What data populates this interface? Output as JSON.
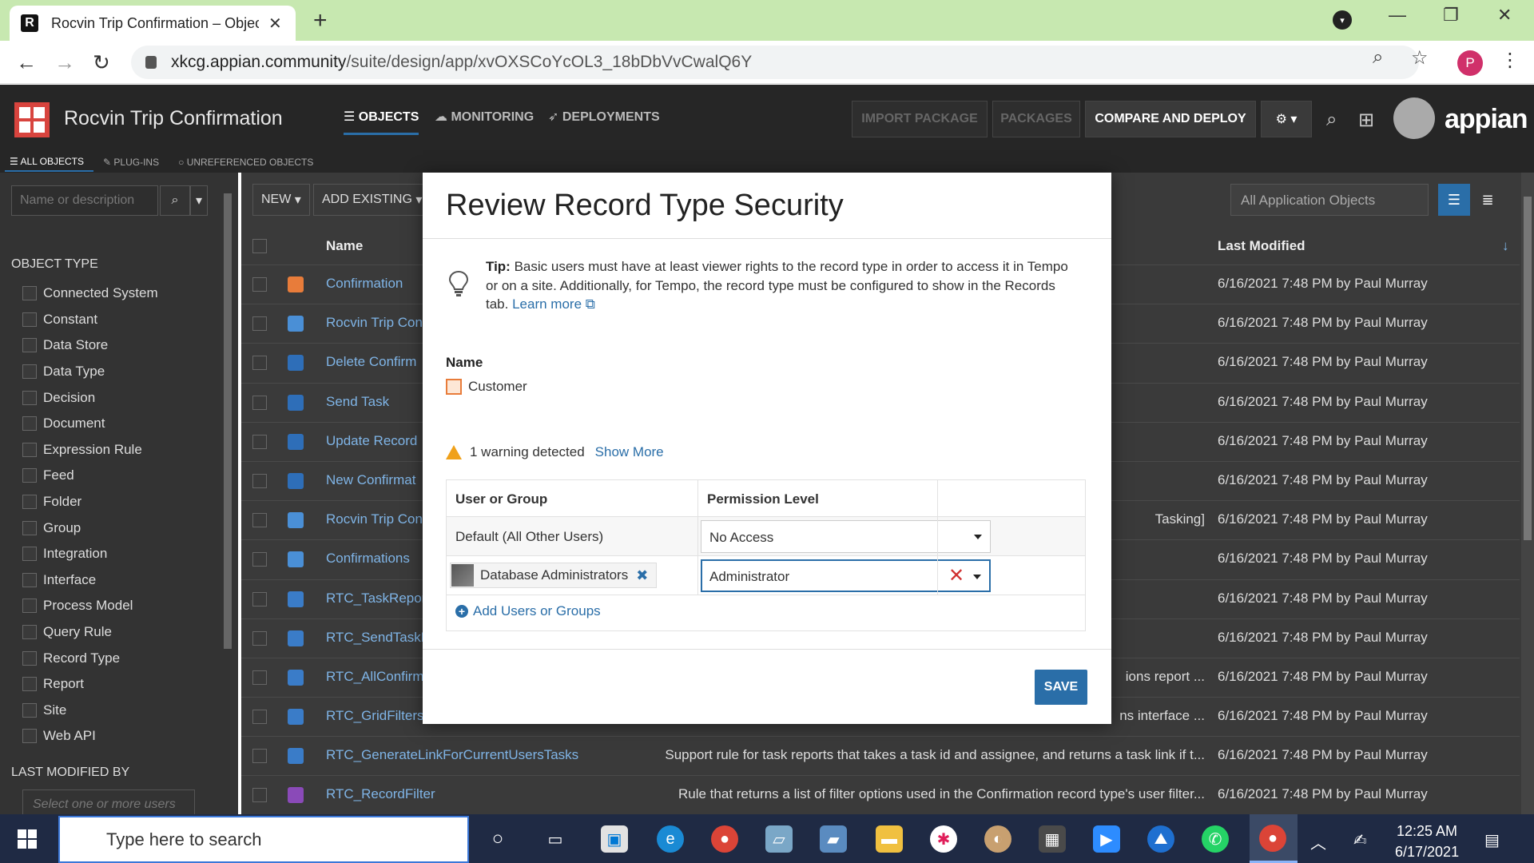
{
  "browser": {
    "tab_title": "Rocvin Trip Confirmation – Objec",
    "tab_favicon": "R",
    "url_host": "xkcg.appian.community",
    "url_path": "/suite/design/app/xvOXSCoYcOL3_18bDbVvCwalQ6Y",
    "profile_initial": "P"
  },
  "app": {
    "title": "Rocvin Trip Confirmation",
    "nav": [
      "OBJECTS",
      "MONITORING",
      "DEPLOYMENTS"
    ],
    "buttons": {
      "import": "IMPORT PACKAGE",
      "packages": "PACKAGES",
      "compare": "COMPARE AND DEPLOY"
    },
    "brand": "appian",
    "subnav": [
      "ALL OBJECTS",
      "PLUG-INS",
      "UNREFERENCED OBJECTS"
    ]
  },
  "sidebar": {
    "search_placeholder": "Name or description",
    "object_type_heading": "OBJECT TYPE",
    "object_types": [
      "Connected System",
      "Constant",
      "Data Store",
      "Data Type",
      "Decision",
      "Document",
      "Expression Rule",
      "Feed",
      "Folder",
      "Group",
      "Integration",
      "Interface",
      "Process Model",
      "Query Rule",
      "Record Type",
      "Report",
      "Site",
      "Web API"
    ],
    "last_modified_heading": "LAST MODIFIED BY",
    "users_placeholder": "Select one or more users"
  },
  "list": {
    "new_label": "NEW",
    "add_existing_label": "ADD EXISTING",
    "filter_value": "All Application Objects",
    "col_name": "Name",
    "col_modified": "Last Modified",
    "rows": [
      {
        "name": "Confirmation",
        "desc": "",
        "date": "6/16/2021 7:48 PM by Paul Murray",
        "color": "#e87c3a"
      },
      {
        "name": "Rocvin Trip Con",
        "desc": "",
        "date": "6/16/2021 7:48 PM by Paul Murray",
        "color": "#4a8fd6"
      },
      {
        "name": "Delete Confirm",
        "desc": "",
        "date": "6/16/2021 7:48 PM by Paul Murray",
        "color": "#2e6eb8"
      },
      {
        "name": "Send Task",
        "desc": "",
        "date": "6/16/2021 7:48 PM by Paul Murray",
        "color": "#2e6eb8"
      },
      {
        "name": "Update Record",
        "desc": "",
        "date": "6/16/2021 7:48 PM by Paul Murray",
        "color": "#2e6eb8"
      },
      {
        "name": "New Confirmat",
        "desc": "",
        "date": "6/16/2021 7:48 PM by Paul Murray",
        "color": "#2e6eb8"
      },
      {
        "name": "Rocvin Trip Con",
        "desc": "Tasking]",
        "date": "6/16/2021 7:48 PM by Paul Murray",
        "color": "#4a8fd6"
      },
      {
        "name": "Confirmations",
        "desc": "",
        "date": "6/16/2021 7:48 PM by Paul Murray",
        "color": "#4a8fd6"
      },
      {
        "name": "RTC_TaskRepor",
        "desc": "",
        "date": "6/16/2021 7:48 PM by Paul Murray",
        "color": "#3a7cc8"
      },
      {
        "name": "RTC_SendTaskF",
        "desc": "",
        "date": "6/16/2021 7:48 PM by Paul Murray",
        "color": "#3a7cc8"
      },
      {
        "name": "RTC_AllConfirm",
        "desc": "ions report ...",
        "date": "6/16/2021 7:48 PM by Paul Murray",
        "color": "#3a7cc8"
      },
      {
        "name": "RTC_GridFilters",
        "desc": "ns interface ...",
        "date": "6/16/2021 7:48 PM by Paul Murray",
        "color": "#3a7cc8"
      },
      {
        "name": "RTC_GenerateLinkForCurrentUsersTasks",
        "desc": "Support rule for task reports that takes a task id and assignee, and returns a task link if t...",
        "date": "6/16/2021 7:48 PM by Paul Murray",
        "color": "#3a7cc8"
      },
      {
        "name": "RTC_RecordFilter",
        "desc": "Rule that returns a list of filter options used in the Confirmation record type's user filter...",
        "date": "6/16/2021 7:48 PM by Paul Murray",
        "color": "#8a4ab8"
      }
    ]
  },
  "modal": {
    "title": "Review Record Type Security",
    "tip_label": "Tip:",
    "tip_text": " Basic users must have at least viewer rights to the record type in order to access it in Tempo or on a site. Additionally, for Tempo, the record type must be configured to show in the Records tab. ",
    "learn_more": "Learn more",
    "name_label": "Name",
    "record_name": "Customer",
    "warning_text": "1 warning detected",
    "show_more": "Show More",
    "col_user": "User or Group",
    "col_permission": "Permission Level",
    "row_default_user": "Default (All Other Users)",
    "row_default_permission": "No Access",
    "row_group": "Database Administrators",
    "row_group_permission": "Administrator",
    "add_users": "Add Users or Groups",
    "save": "SAVE"
  },
  "taskbar": {
    "search_placeholder": "Type here to search",
    "time": "12:25 AM",
    "date": "6/17/2021"
  }
}
